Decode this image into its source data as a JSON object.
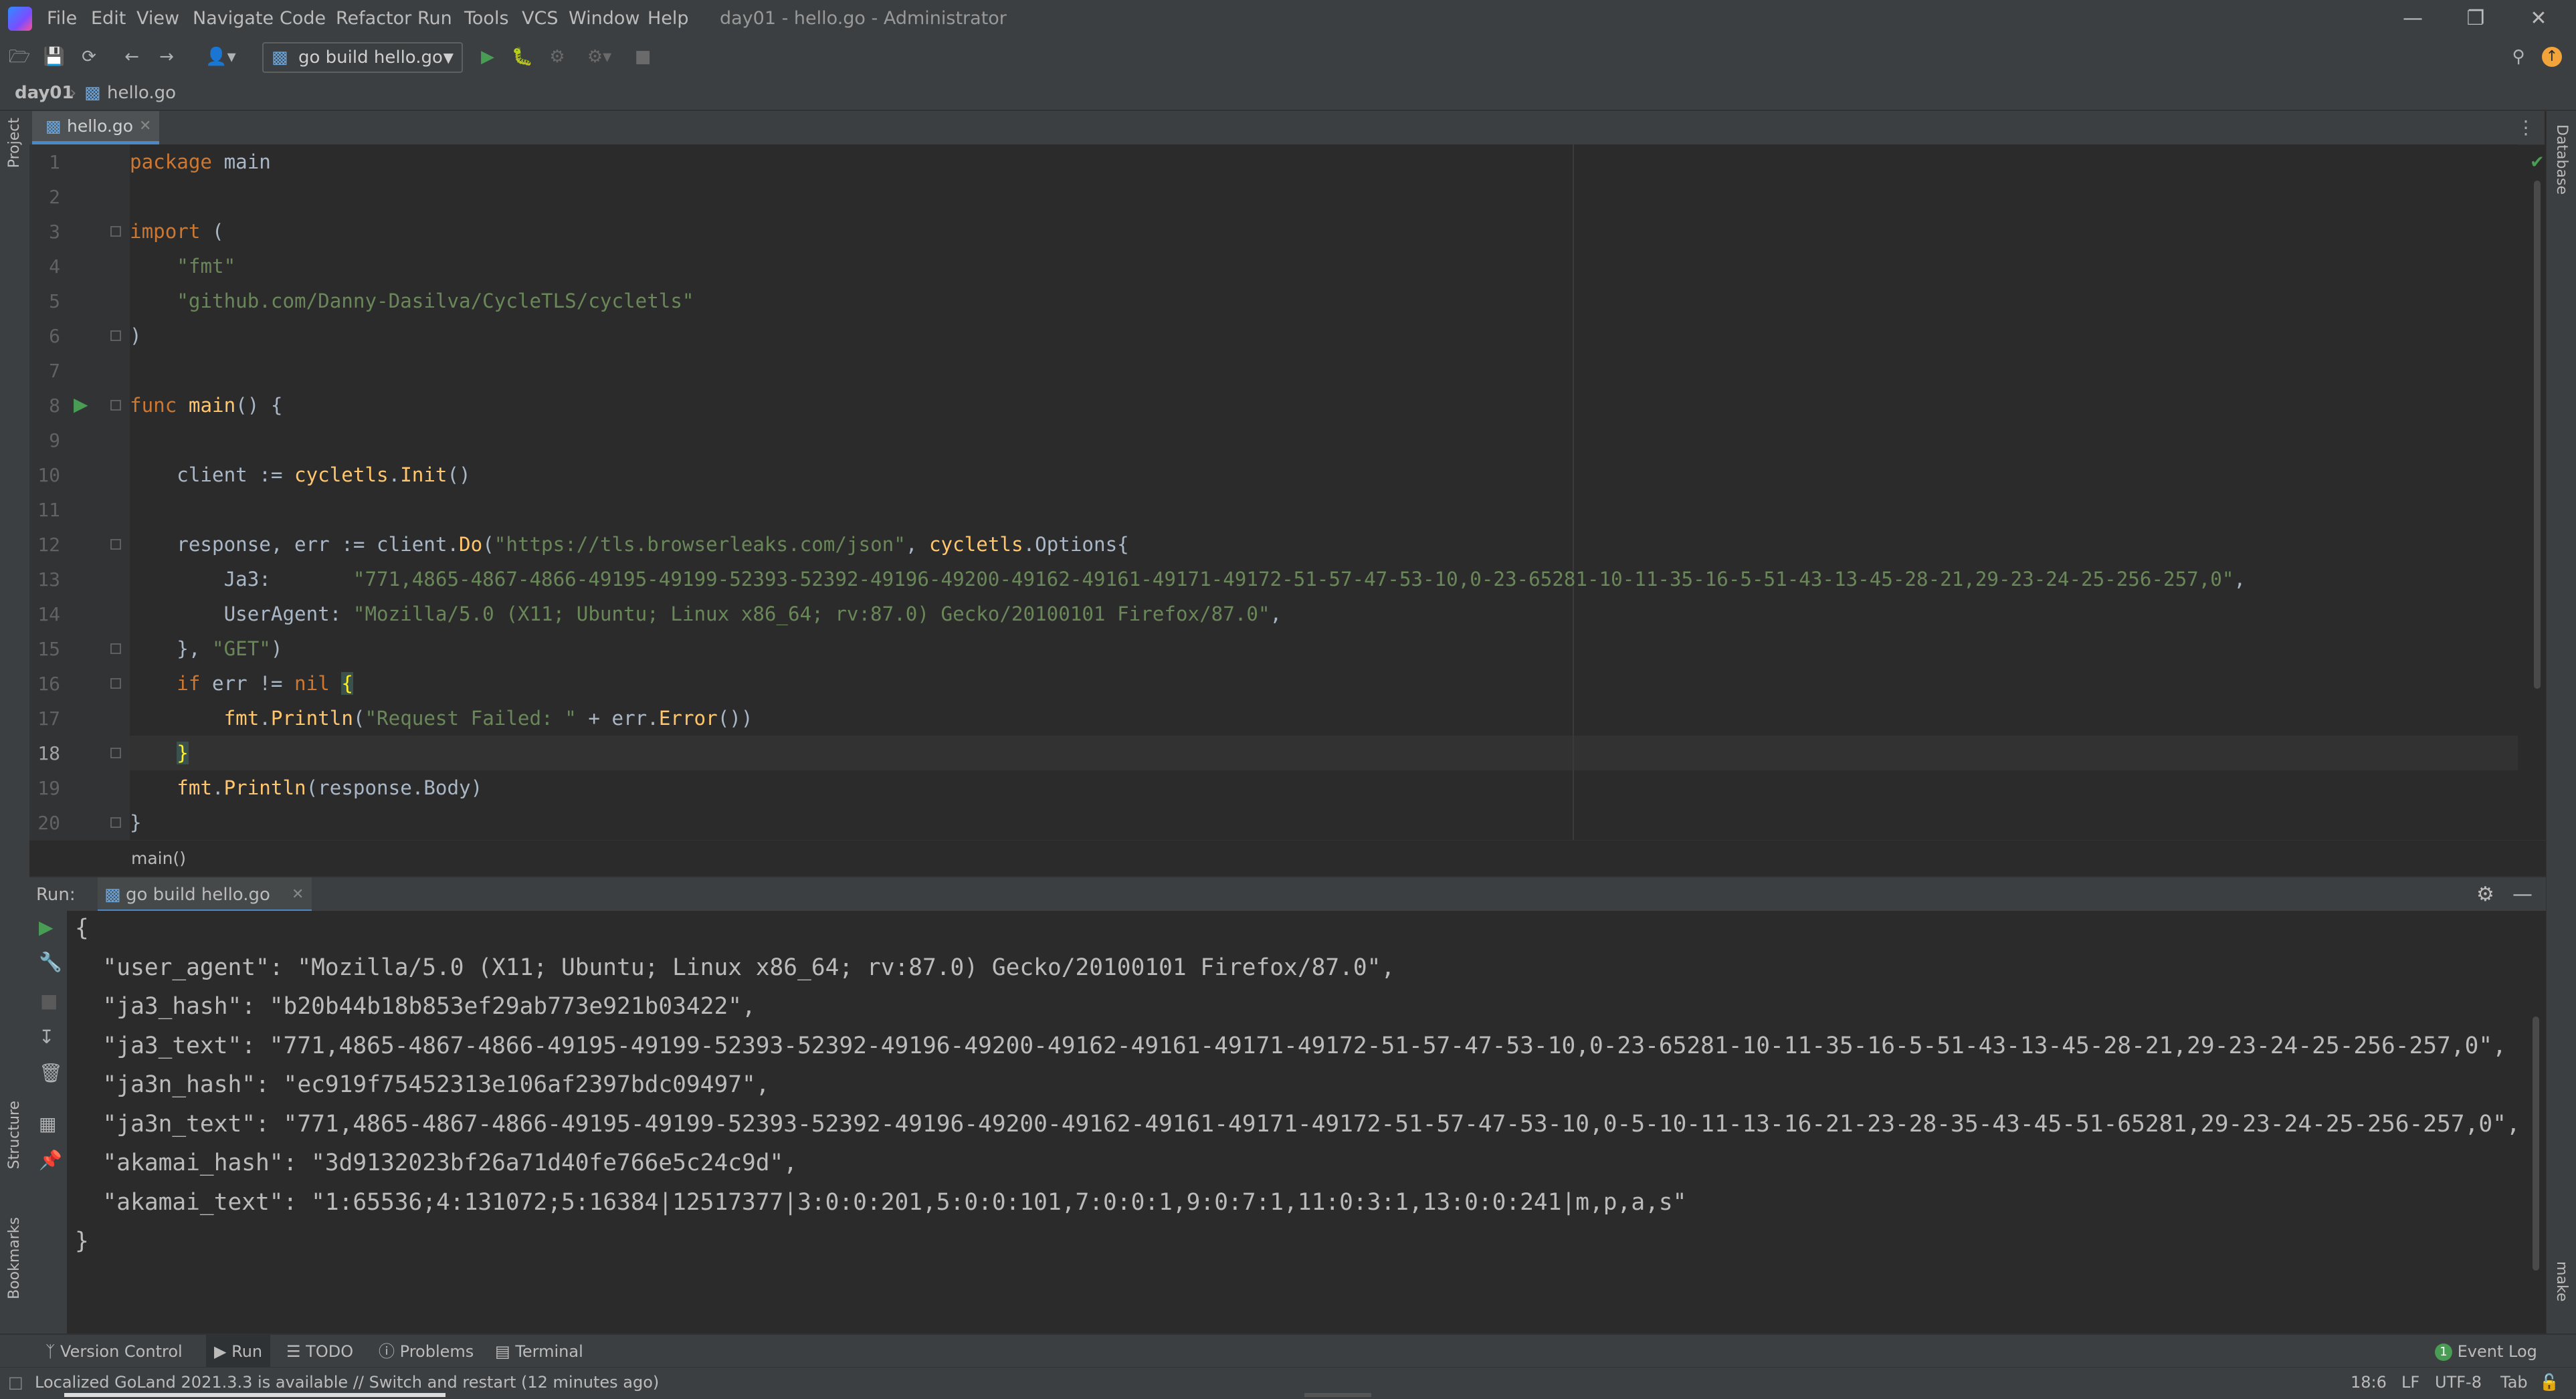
{
  "window": {
    "menu": [
      "File",
      "Edit",
      "View",
      "Navigate",
      "Code",
      "Refactor",
      "Run",
      "Tools",
      "VCS",
      "Window",
      "Help"
    ],
    "title": "day01 - hello.go - Administrator"
  },
  "toolbar": {
    "run_config": "go build hello.go"
  },
  "breadcrumb": {
    "project": "day01",
    "file": "hello.go"
  },
  "editor": {
    "tab_label": "hello.go",
    "current_line": 18,
    "lines": [
      {
        "n": "1",
        "parts": [
          [
            "kw",
            "package"
          ],
          [
            "t",
            " main"
          ]
        ]
      },
      {
        "n": "2",
        "parts": []
      },
      {
        "n": "3",
        "parts": [
          [
            "kw",
            "import"
          ],
          [
            "t",
            " ("
          ]
        ]
      },
      {
        "n": "4",
        "parts": [
          [
            "t",
            "    "
          ],
          [
            "st",
            "\"fmt\""
          ]
        ]
      },
      {
        "n": "5",
        "parts": [
          [
            "t",
            "    "
          ],
          [
            "st",
            "\"github.com/Danny-Dasilva/CycleTLS/cycletls\""
          ]
        ]
      },
      {
        "n": "6",
        "parts": [
          [
            "t",
            ")"
          ]
        ]
      },
      {
        "n": "7",
        "parts": []
      },
      {
        "n": "8",
        "parts": [
          [
            "kw",
            "func"
          ],
          [
            "t",
            " "
          ],
          [
            "fn",
            "main"
          ],
          [
            "t",
            "() {"
          ]
        ]
      },
      {
        "n": "9",
        "parts": []
      },
      {
        "n": "10",
        "parts": [
          [
            "t",
            "    client := "
          ],
          [
            "fn",
            "cycletls"
          ],
          [
            "t",
            "."
          ],
          [
            "fn",
            "Init"
          ],
          [
            "t",
            "()"
          ]
        ]
      },
      {
        "n": "11",
        "parts": []
      },
      {
        "n": "12",
        "parts": [
          [
            "t",
            "    response, err := client."
          ],
          [
            "fn",
            "Do"
          ],
          [
            "t",
            "("
          ],
          [
            "st",
            "\"https://tls.browserleaks.com/json\""
          ],
          [
            "t",
            ", "
          ],
          [
            "fn",
            "cycletls"
          ],
          [
            "t",
            "."
          ],
          [
            "ty",
            "Options"
          ],
          [
            "t",
            "{"
          ]
        ]
      },
      {
        "n": "13",
        "parts": [
          [
            "t",
            "        Ja3:       "
          ],
          [
            "st",
            "\"771,4865-4867-4866-49195-49199-52393-52392-49196-49200-49162-49161-49171-49172-51-57-47-53-10,0-23-65281-10-11-35-16-5-51-43-13-45-28-21,29-23-24-25-256-257,0\""
          ],
          [
            "t",
            ","
          ]
        ]
      },
      {
        "n": "14",
        "parts": [
          [
            "t",
            "        UserAgent: "
          ],
          [
            "st",
            "\"Mozilla/5.0 (X11; Ubuntu; Linux x86_64; rv:87.0) Gecko/20100101 Firefox/87.0\""
          ],
          [
            "t",
            ","
          ]
        ]
      },
      {
        "n": "15",
        "parts": [
          [
            "t",
            "    }, "
          ],
          [
            "st",
            "\"GET\""
          ],
          [
            "t",
            ")"
          ]
        ]
      },
      {
        "n": "16",
        "parts": [
          [
            "t",
            "    "
          ],
          [
            "kw",
            "if"
          ],
          [
            "t",
            " err != "
          ],
          [
            "kw",
            "nil"
          ],
          [
            "t",
            " "
          ],
          [
            "br",
            "{"
          ]
        ]
      },
      {
        "n": "17",
        "parts": [
          [
            "t",
            "        "
          ],
          [
            "fn",
            "fmt"
          ],
          [
            "t",
            "."
          ],
          [
            "fn",
            "Println"
          ],
          [
            "t",
            "("
          ],
          [
            "st",
            "\"Request Failed: \""
          ],
          [
            "t",
            " + err."
          ],
          [
            "fn",
            "Error"
          ],
          [
            "t",
            "())"
          ]
        ]
      },
      {
        "n": "18",
        "parts": [
          [
            "t",
            "    "
          ],
          [
            "br",
            "}"
          ]
        ]
      },
      {
        "n": "19",
        "parts": [
          [
            "t",
            "    "
          ],
          [
            "fn",
            "fmt"
          ],
          [
            "t",
            "."
          ],
          [
            "fn",
            "Println"
          ],
          [
            "t",
            "(response.Body)"
          ]
        ]
      },
      {
        "n": "20",
        "parts": [
          [
            "t",
            "}"
          ]
        ]
      }
    ],
    "breadcrumb_func": "main()"
  },
  "run_panel": {
    "label": "Run:",
    "tab_label": "go build hello.go",
    "output": [
      "{",
      "  \"user_agent\": \"Mozilla/5.0 (X11; Ubuntu; Linux x86_64; rv:87.0) Gecko/20100101 Firefox/87.0\",",
      "  \"ja3_hash\": \"b20b44b18b853ef29ab773e921b03422\",",
      "  \"ja3_text\": \"771,4865-4867-4866-49195-49199-52393-52392-49196-49200-49162-49161-49171-49172-51-57-47-53-10,0-23-65281-10-11-35-16-5-51-43-13-45-28-21,29-23-24-25-256-257,0\",",
      "  \"ja3n_hash\": \"ec919f75452313e106af2397bdc09497\",",
      "  \"ja3n_text\": \"771,4865-4867-4866-49195-49199-52393-52392-49196-49200-49162-49161-49171-49172-51-57-47-53-10,0-5-10-11-13-16-21-23-28-35-43-45-51-65281,29-23-24-25-256-257,0\",",
      "  \"akamai_hash\": \"3d9132023bf26a71d40fe766e5c24c9d\",",
      "  \"akamai_text\": \"1:65536;4:131072;5:16384|12517377|3:0:0:201,5:0:0:101,7:0:0:1,9:0:7:1,11:0:3:1,13:0:0:241|m,p,a,s\"",
      "}"
    ]
  },
  "side_tools": {
    "left_top": "Project",
    "left_structure": "Structure",
    "left_bookmarks": "Bookmarks",
    "right_database": "Database",
    "right_make": "make"
  },
  "bottom_tabs": [
    "Version Control",
    "Run",
    "TODO",
    "Problems",
    "Terminal"
  ],
  "event_log": "Event Log",
  "event_count": "1",
  "status": {
    "message": "Localized GoLand 2021.3.3 is available // Switch and restart (12 minutes ago)",
    "position": "18:6",
    "line_sep": "LF",
    "encoding": "UTF-8",
    "indent": "Tab"
  },
  "colors": {
    "keyword": "#cc7832",
    "string": "#6a8759",
    "function": "#ffc66d",
    "accent": "#4a88c7",
    "run_green": "#499c54"
  }
}
